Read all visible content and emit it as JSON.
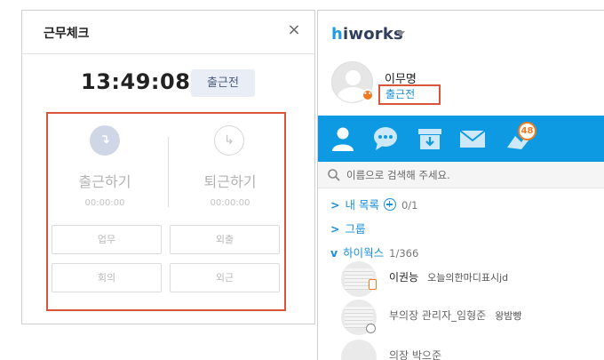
{
  "attendance": {
    "title": "근무체크",
    "close_glyph": "×",
    "clock": "13:49:08",
    "status": "출근전",
    "check_in": {
      "label": "출근하기",
      "time": "00:00:00",
      "icon": "checkin-arrow-icon"
    },
    "check_out": {
      "label": "퇴근하기",
      "time": "00:00:00",
      "icon": "checkout-arrow-icon"
    },
    "buttons": {
      "work": "업무",
      "out": "외출",
      "meeting": "회의",
      "field": "외근"
    }
  },
  "messenger": {
    "brand_h": "h",
    "brand_rest": "iworks",
    "user": {
      "name": "이무명",
      "status": "출근전"
    },
    "tabs": [
      {
        "name": "contacts",
        "icon": "person-icon"
      },
      {
        "name": "chat",
        "icon": "chat-bubble-icon"
      },
      {
        "name": "archive",
        "icon": "archive-box-icon"
      },
      {
        "name": "mail",
        "icon": "envelope-icon"
      },
      {
        "name": "notifications",
        "icon": "bell-icon"
      }
    ],
    "notification_count": "48",
    "search": {
      "placeholder": "이름으로 검색해 주세요."
    },
    "groups": {
      "mylist": {
        "arrow": ">",
        "label": "내 목록",
        "count": "0/1"
      },
      "groups": {
        "arrow": ">",
        "label": "그룹"
      },
      "hiworks": {
        "arrow": "v",
        "label": "하이웍스",
        "count": "1/366"
      }
    },
    "people": [
      {
        "name": "이권능",
        "message": "오늘의한마디표시jd"
      },
      {
        "name": "부의장 관리자_임형준",
        "message": "왕밤빵"
      },
      {
        "name": "의장 박으준",
        "message": ""
      }
    ],
    "colors": {
      "accent": "#0e9ae3",
      "highlight_border": "#d9553a",
      "badge": "#f07a1f"
    }
  }
}
